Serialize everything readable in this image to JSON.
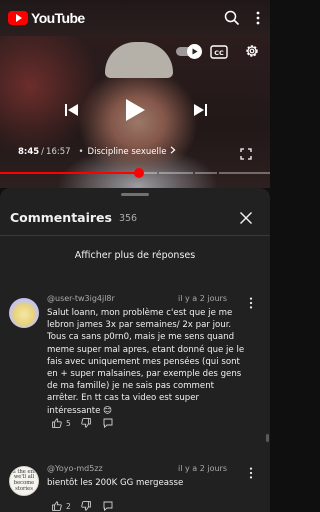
{
  "app": {
    "logo_text": "YouTube",
    "brand_color": "#ff0000"
  },
  "topbar": {
    "icons": [
      "search-icon",
      "more-vert-icon"
    ]
  },
  "player": {
    "current_time": "8:45",
    "separator": "/",
    "total_time": "16:57",
    "chapter_bullet": "•",
    "chapter_title": "Discipline sexuelle",
    "chapter_chevron": "›",
    "autoplay_enabled": true,
    "progress_fraction": 0.516,
    "controls": [
      "autoplay-toggle",
      "captions-button",
      "settings-icon",
      "previous-icon",
      "play-icon",
      "next-icon",
      "fullscreen-icon"
    ]
  },
  "comments": {
    "title": "Commentaires",
    "count": "356",
    "more_replies_label": "Afficher plus de réponses",
    "items": [
      {
        "author": "@user-tw3ig4jl8r",
        "date": "il y a 2 jours",
        "text": "Salut loann, mon problème c'est que je me lebron james 3x par semaines/ 2x par jour. Tous ca sans p0rn0, mais je me sens quand meme super mal apres, etant donné que je le fais avec uniquement mes pensées (qui sont en + super malsaines, par exemple des gens de ma famille) je ne sais pas comment arrêter. En tt cas ta video est super intéressante 😊",
        "likes": "5"
      },
      {
        "author": "@Yoyo-md5zz",
        "date": "il y a 2 jours",
        "text": "bientôt les 200K GG mergeasse",
        "likes": "2",
        "avatar_text": "in the end we'll all become stories"
      }
    ]
  }
}
